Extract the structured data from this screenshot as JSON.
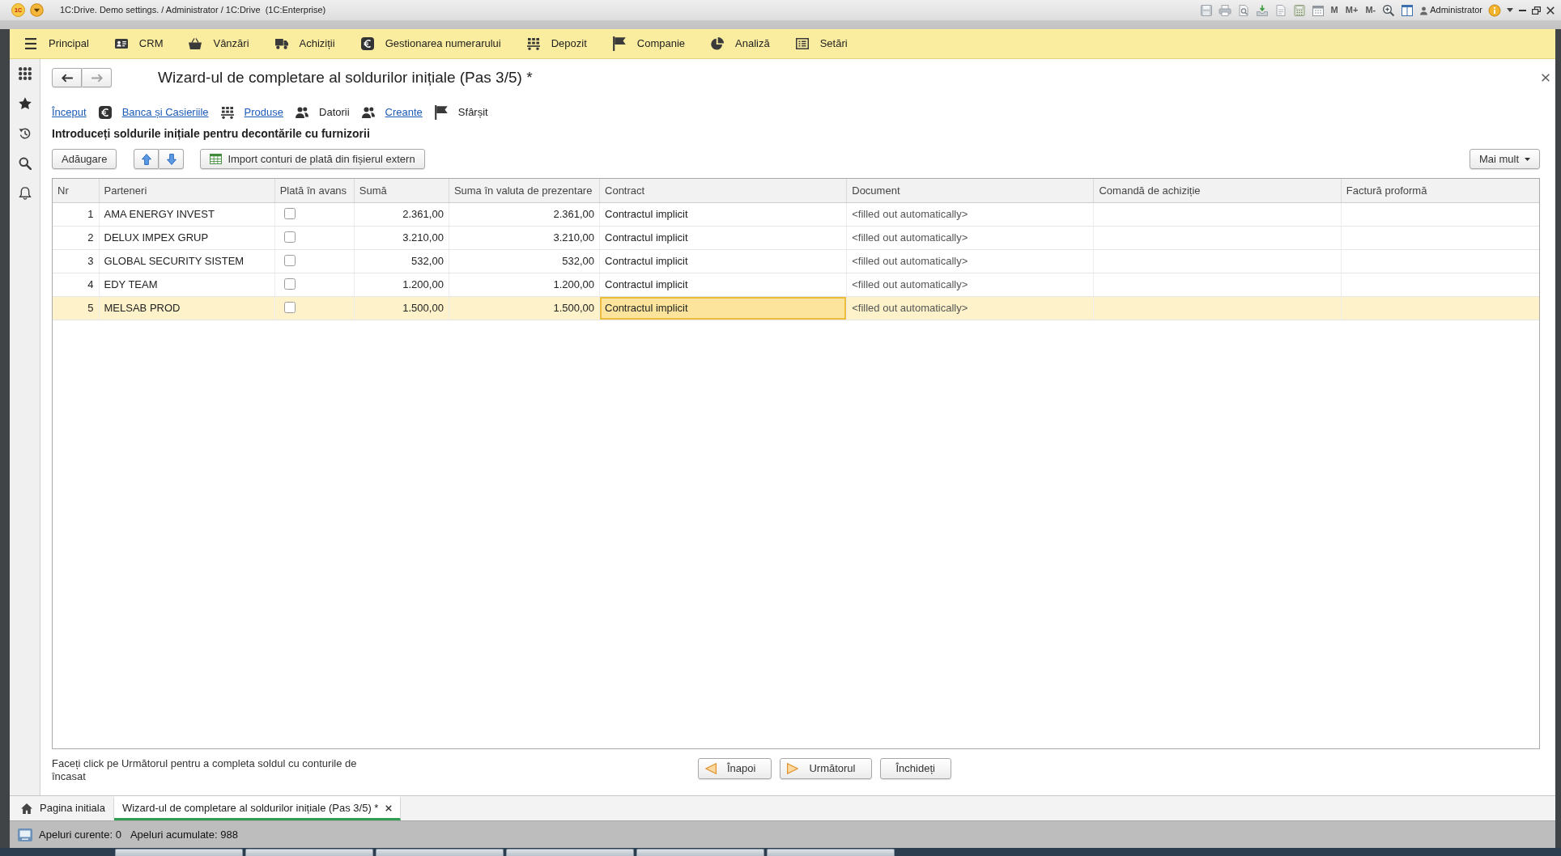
{
  "window": {
    "logo": "1C",
    "title": "1C:Drive. Demo settings. / Administrator / 1C:Drive  (1C:Enterprise)",
    "memory_buttons": [
      "M",
      "M+",
      "M-"
    ],
    "user": "Administrator"
  },
  "sections": [
    {
      "label": "Principal"
    },
    {
      "label": "CRM"
    },
    {
      "label": "Vânzări"
    },
    {
      "label": "Achiziții"
    },
    {
      "label": "Gestionarea numerarului"
    },
    {
      "label": "Depozit"
    },
    {
      "label": "Companie"
    },
    {
      "label": "Analiză"
    },
    {
      "label": "Setări"
    }
  ],
  "form": {
    "title": "Wizard-ul de completare al soldurilor inițiale (Pas 3/5) *",
    "steps": [
      {
        "label": "Început",
        "kind": "link"
      },
      {
        "label": "Banca și Casieriile",
        "kind": "link"
      },
      {
        "label": "Produse",
        "kind": "link"
      },
      {
        "label": "Datorii",
        "kind": "text"
      },
      {
        "label": "Creante",
        "kind": "link"
      },
      {
        "label": "Sfârșit",
        "kind": "text"
      }
    ],
    "instruction": "Introduceți soldurile inițiale pentru decontările cu furnizorii",
    "toolbar": {
      "add_button": "Adăugare",
      "import_button": "Import conturi de plată din fișierul extern",
      "more_button": "Mai mult"
    },
    "table": {
      "columns": [
        {
          "label": "Nr",
          "focused": false
        },
        {
          "label": "Parteneri",
          "focused": false
        },
        {
          "label": "Plată în avans",
          "focused": false
        },
        {
          "label": "Sumă",
          "focused": false
        },
        {
          "label": "Suma în valuta de prezentare",
          "focused": false
        },
        {
          "label": "Contract",
          "focused": true
        },
        {
          "label": "Document",
          "focused": false
        },
        {
          "label": "Comandă de achiziție",
          "focused": false
        },
        {
          "label": "Factură proformă",
          "focused": false
        }
      ],
      "rows": [
        {
          "nr": "1",
          "partner": "AMA ENERGY INVEST",
          "checked": false,
          "amount": "2.361,00",
          "amount_presentation": "2.361,00",
          "contract": "Contractul implicit",
          "document": "<filled out automatically>",
          "selected": false
        },
        {
          "nr": "2",
          "partner": "DELUX IMPEX GRUP",
          "checked": false,
          "amount": "3.210,00",
          "amount_presentation": "3.210,00",
          "contract": "Contractul implicit",
          "document": "<filled out automatically>",
          "selected": false
        },
        {
          "nr": "3",
          "partner": "GLOBAL SECURITY SISTEM",
          "checked": false,
          "amount": "532,00",
          "amount_presentation": "532,00",
          "contract": "Contractul implicit",
          "document": "<filled out automatically>",
          "selected": false
        },
        {
          "nr": "4",
          "partner": "EDY TEAM",
          "checked": false,
          "amount": "1.200,00",
          "amount_presentation": "1.200,00",
          "contract": "Contractul implicit",
          "document": "<filled out automatically>",
          "selected": false
        },
        {
          "nr": "5",
          "partner": "MELSAB PROD",
          "checked": false,
          "amount": "1.500,00",
          "amount_presentation": "1.500,00",
          "contract": "Contractul implicit",
          "document": "<filled out automatically>",
          "selected": true
        }
      ]
    },
    "hint": "Faceți click pe Următorul pentru a completa soldul cu conturile de încasat",
    "buttons": [
      {
        "label": "Înapoi",
        "kind": "back"
      },
      {
        "label": "Următorul",
        "kind": "next"
      },
      {
        "label": "Închideți",
        "kind": "close"
      }
    ]
  },
  "open_tabs": [
    {
      "label": "Pagina initiala",
      "selected": false
    },
    {
      "label": "Wizard-ul de completare al soldurilor inițiale (Pas 3/5) *",
      "selected": true
    }
  ],
  "status_bar": {
    "current_calls": "Apeluri curente: 0",
    "accumulated_calls": "Apeluri acumulate: 988"
  }
}
